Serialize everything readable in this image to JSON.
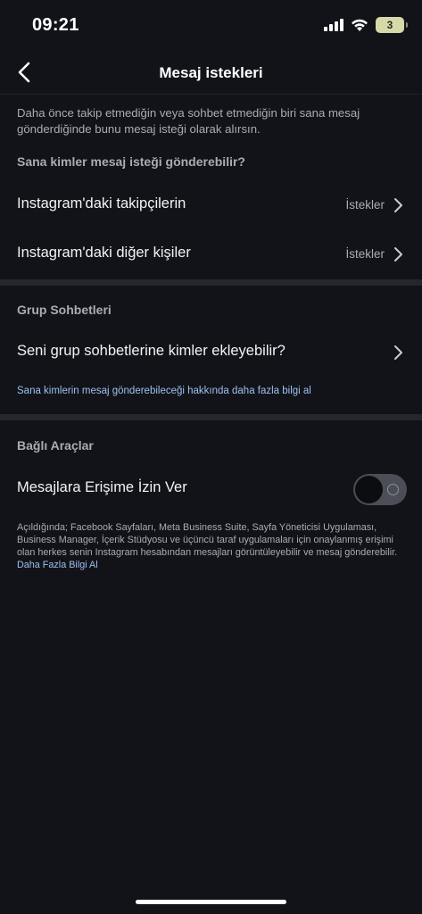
{
  "status": {
    "time": "09:21",
    "battery": "3",
    "icons": [
      "signal-icon",
      "wifi-icon",
      "battery-icon"
    ]
  },
  "header": {
    "title": "Mesaj istekleri",
    "back_icon": "back-chevron-icon"
  },
  "description": "Daha önce takip etmediğin veya sohbet etmediğin biri sana mesaj gönderdiğinde bunu mesaj isteği olarak alırsın.",
  "requests_section": {
    "heading": "Sana kimler mesaj isteği gönderebilir?",
    "rows": [
      {
        "label": "Instagram'daki takipçilerin",
        "value": "İstekler"
      },
      {
        "label": "Instagram'daki diğer kişiler",
        "value": "İstekler"
      }
    ]
  },
  "group_section": {
    "heading": "Grup Sohbetleri",
    "row_label": "Seni grup sohbetlerine kimler ekleyebilir?",
    "learn_more": "Sana kimlerin mesaj gönderebileceği hakkında daha fazla bilgi al"
  },
  "tools_section": {
    "heading": "Bağlı Araçlar",
    "toggle_label": "Mesajlara Erişime İzin Ver",
    "toggle_on": false,
    "footnote": "Açıldığında; Facebook Sayfaları, Meta Business Suite, Sayfa Yöneticisi Uygulaması, Business Manager, İçerik Stüdyosu ve üçüncü taraf uygulamaları için onaylanmış erişimi olan herkes senin Instagram hesabından mesajları görüntüleyebilir ve mesaj gönderebilir.",
    "footnote_link": "Daha Fazla Bilgi Al"
  },
  "colors": {
    "background": "#121318",
    "link": "#9cc0ee",
    "divider": "#25272d"
  }
}
